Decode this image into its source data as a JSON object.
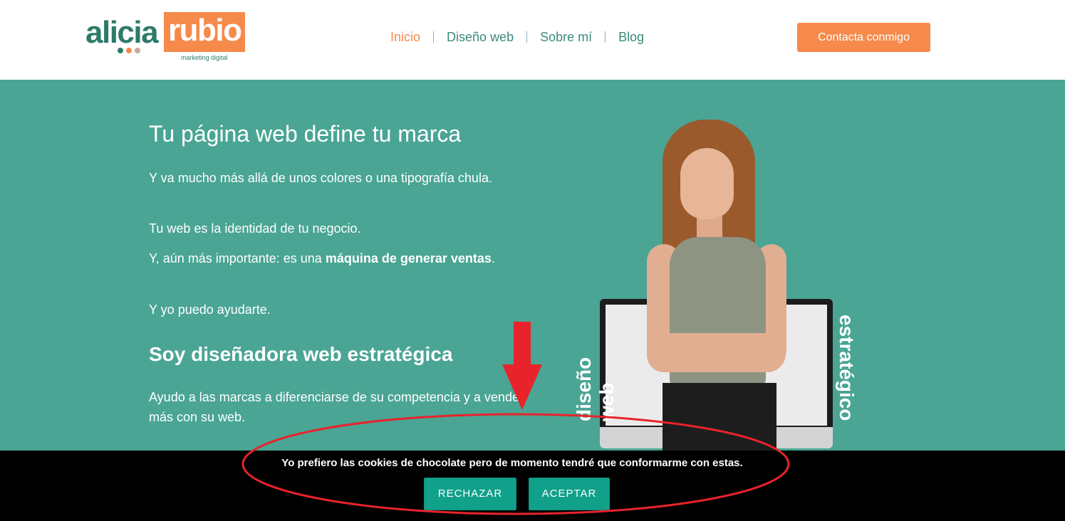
{
  "header": {
    "logo": {
      "part1": "alicia",
      "part2": "rubio",
      "tagline": "marketing digital",
      "colors": {
        "green": "#2e7a6a",
        "orange": "#f58a4b",
        "dot3": "#c9a99a"
      }
    },
    "nav": [
      {
        "label": "Inicio",
        "active": true
      },
      {
        "label": "Diseño web",
        "active": false
      },
      {
        "label": "Sobre mí",
        "active": false
      },
      {
        "label": "Blog",
        "active": false
      }
    ],
    "cta_label": "Contacta conmigo"
  },
  "hero": {
    "title": "Tu página web define tu marca",
    "p1": "Y va mucho más allá de unos colores o una tipografía chula.",
    "p2": "Tu web es la identidad de tu negocio.",
    "p3_prefix": "Y, aún más importante: es una ",
    "p3_bold": "máquina de generar ventas",
    "p3_suffix": ".",
    "p4": "Y yo puedo ayudarte.",
    "subtitle": "Soy diseñadora web estratégica",
    "p5": "Ayudo a las marcas a diferenciarse de su competencia y a vender más con su web.",
    "image_text_left": "diseño web",
    "image_text_right": "estratégico",
    "background_color": "#4aa594"
  },
  "cookie_bar": {
    "message": "Yo prefiero las cookies de chocolate pero de momento tendré que conformarme con estas.",
    "reject_label": "RECHAZAR",
    "accept_label": "ACEPTAR",
    "button_color": "#11a08a"
  },
  "annotations": {
    "arrow_icon": "red-down-arrow",
    "ellipse_icon": "red-ellipse-highlight",
    "color": "#e8232b"
  }
}
